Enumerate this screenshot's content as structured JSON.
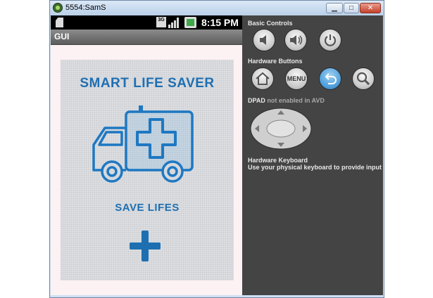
{
  "window": {
    "title": "5554:SamS",
    "buttons": {
      "minimize": "▁",
      "maximize": "□",
      "close": "✕"
    }
  },
  "statusbar": {
    "network_badge": "3G",
    "time": "8:15 PM",
    "icons": [
      "sd-card-icon",
      "3g-icon",
      "signal-icon",
      "battery-icon"
    ]
  },
  "app": {
    "title": "GUI",
    "headline": "SMART LIFE SAVER",
    "subtitle": "SAVE LIFES",
    "image": "ambulance-icon",
    "action_icon": "plus-icon"
  },
  "controls": {
    "basic_label": "Basic Controls",
    "basic_buttons": [
      "volume-down-icon",
      "volume-up-icon",
      "power-icon"
    ],
    "hardware_label": "Hardware Buttons",
    "hardware_buttons": [
      "home-icon",
      "menu-button",
      "back-icon",
      "search-icon"
    ],
    "menu_label": "MENU",
    "dpad_label": "DPAD",
    "dpad_note": "not enabled in AVD",
    "keyboard_label": "Hardware Keyboard",
    "keyboard_note": "Use your physical keyboard to provide input"
  },
  "colors": {
    "brand_blue": "#1e6fb2",
    "controls_bg": "#444444",
    "active_button": "#4f9fdb"
  }
}
